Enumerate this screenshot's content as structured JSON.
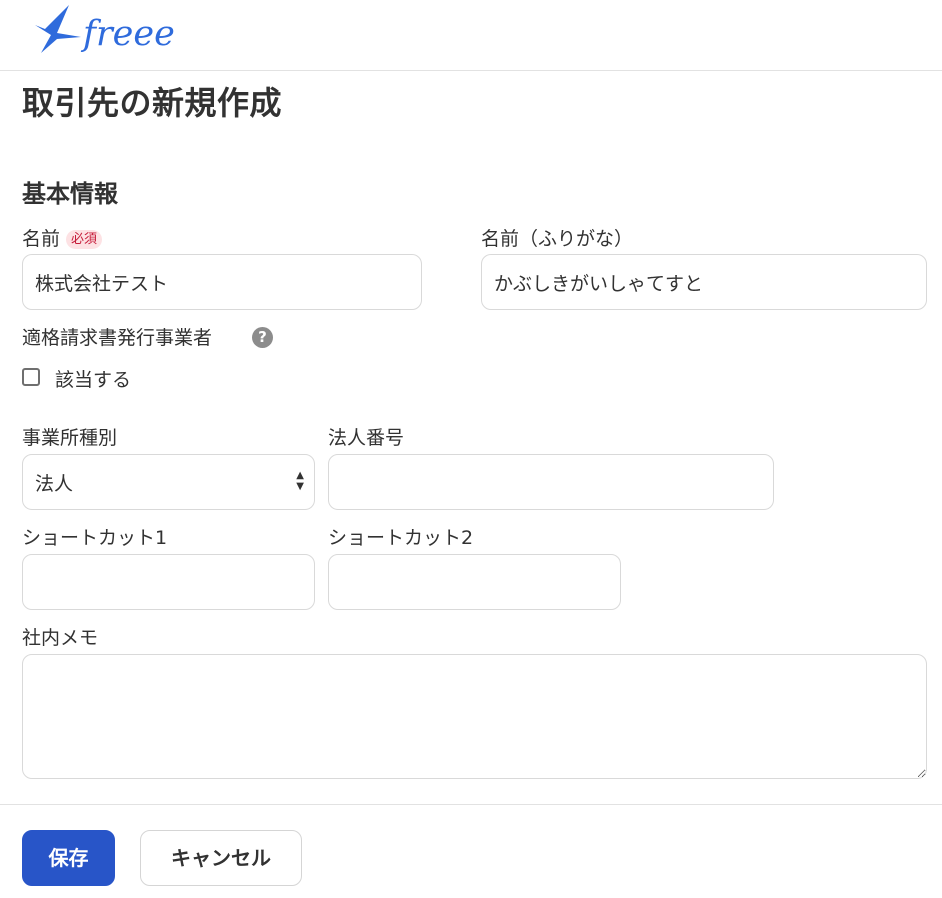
{
  "header": {
    "logo_text": "freee"
  },
  "page": {
    "title": "取引先の新規作成"
  },
  "section": {
    "title": "基本情報"
  },
  "form": {
    "name": {
      "label": "名前",
      "badge": "必須",
      "value": "株式会社テスト"
    },
    "name_kana": {
      "label": "名前（ふりがな）",
      "value": "かぶしきがいしゃてすと"
    },
    "invoice": {
      "label": "適格請求書発行事業者",
      "help_icon": "question-circle-icon",
      "checkbox_label": "該当する",
      "checked": false
    },
    "business_type": {
      "label": "事業所種別",
      "value": "法人"
    },
    "corporate_number": {
      "label": "法人番号",
      "value": ""
    },
    "shortcut1": {
      "label": "ショートカット1",
      "value": ""
    },
    "shortcut2": {
      "label": "ショートカット2",
      "value": ""
    },
    "memo": {
      "label": "社内メモ",
      "value": ""
    }
  },
  "actions": {
    "save_label": "保存",
    "cancel_label": "キャンセル"
  },
  "colors": {
    "brand": "#2f6bdc",
    "primary_button": "#2855c8",
    "required_badge_bg": "#fde2e4",
    "required_badge_text": "#c61d3b"
  }
}
